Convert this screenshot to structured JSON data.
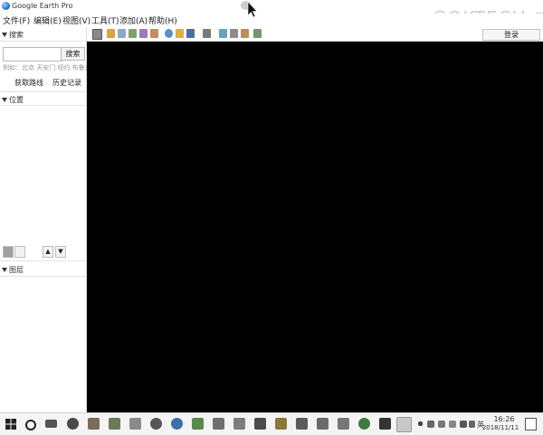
{
  "window": {
    "title": "Google Earth Pro",
    "watermark": "GOKTECH",
    "watermark_glyph": "易"
  },
  "menu": [
    "文件(F)",
    "编辑(E)",
    "视图(V)",
    "工具(T)",
    "添加(A)",
    "帮助(H)"
  ],
  "toolbar": {
    "signin_label": "登录"
  },
  "search_panel": {
    "header": "搜索",
    "search_value": "",
    "search_button": "搜索",
    "hint": "例如：北京 天安门 纽约 布鲁克林",
    "directions_link": "获取路线",
    "history_link": "历史记录"
  },
  "places_panel": {
    "header": "位置"
  },
  "layers_panel": {
    "header": "图层"
  },
  "taskbar": {
    "time": "16:26",
    "date": "2018/11/11",
    "language": "英"
  },
  "colors": {
    "map_background": "#000000",
    "chrome_background": "#ffffff",
    "taskbar_background": "#f4f4f4"
  }
}
